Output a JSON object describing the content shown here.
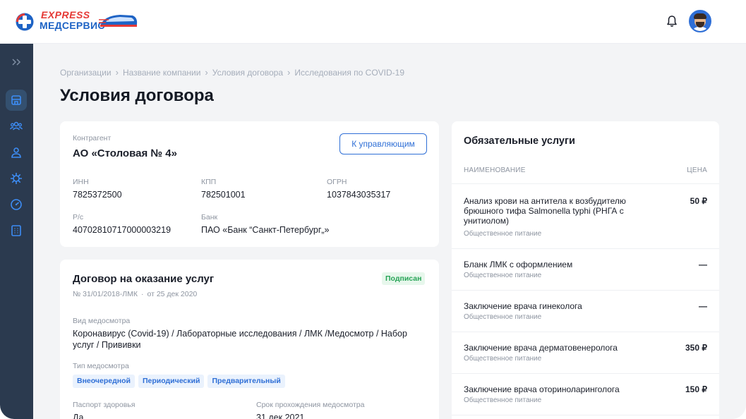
{
  "header": {
    "logo_express": "EXPRESS",
    "logo_med": "МЕДСЕРВИС"
  },
  "breadcrumb": [
    "Организации",
    "Название компании",
    "Условия договора",
    "Исследования по COVID-19"
  ],
  "page_title": "Условия договора",
  "counterparty": {
    "label": "Контрагент",
    "name": "АО «Столовая № 4»",
    "button": "К управляющим",
    "inn_label": "ИНН",
    "inn": "7825372500",
    "kpp_label": "КПП",
    "kpp": "782501001",
    "ogrn_label": "ОГРН",
    "ogrn": "1037843035317",
    "account_label": "Р/с",
    "account": "40702810717000003219",
    "bank_label": "Банк",
    "bank": "ПАО «Банк “Санкт-Петербург„»"
  },
  "contract": {
    "title": "Договор на оказание услуг",
    "status": "Подписан",
    "number": "№ 31/01/2018-ЛМК",
    "date_sep": "·",
    "date": "от 25 дек 2020",
    "exam_kind_label": "Вид медосмотра",
    "exam_kind": "Коронавирус (Covid-19) / Лабораторные исследования / ЛМК /Медосмотр / Набор услуг / Прививки",
    "exam_type_label": "Тип медосмотра",
    "exam_types": [
      "Внеочередной",
      "Периодический",
      "Предварительный"
    ],
    "health_passport_label": "Паспорт здоровья",
    "health_passport": "Да",
    "deadline_label": "Срок прохождения медосмотра",
    "deadline": "31 дек 2021"
  },
  "services": {
    "title": "Обязательные услуги",
    "col_name": "НАИМЕНОВАНИЕ",
    "col_price": "ЦЕНА",
    "rows": [
      {
        "name": "Анализ крови на антитела к возбудителю брюшного тифа Salmonella typhi (РНГА с унитиолом)",
        "sub": "Общественное питание",
        "price": "50 ₽"
      },
      {
        "name": "Бланк ЛМК с оформлением",
        "sub": "Общественное питание",
        "price": "—"
      },
      {
        "name": "Заключение врача гинеколога",
        "sub": "Общественное питание",
        "price": "—"
      },
      {
        "name": "Заключение врача дерматовенеролога",
        "sub": "Общественное питание",
        "price": "350 ₽"
      },
      {
        "name": "Заключение врача оториноларинголога",
        "sub": "Общественное питание",
        "price": "150 ₽"
      }
    ]
  },
  "colors": {
    "accent": "#2f6fd6",
    "sidebar": "#2b3a4f",
    "success": "#27a457",
    "brand_red": "#e53935"
  },
  "icons": [
    "expand-icon",
    "store-icon",
    "users-icon",
    "user-icon",
    "virus-icon",
    "dashboard-icon",
    "building-icon",
    "bell-icon"
  ]
}
